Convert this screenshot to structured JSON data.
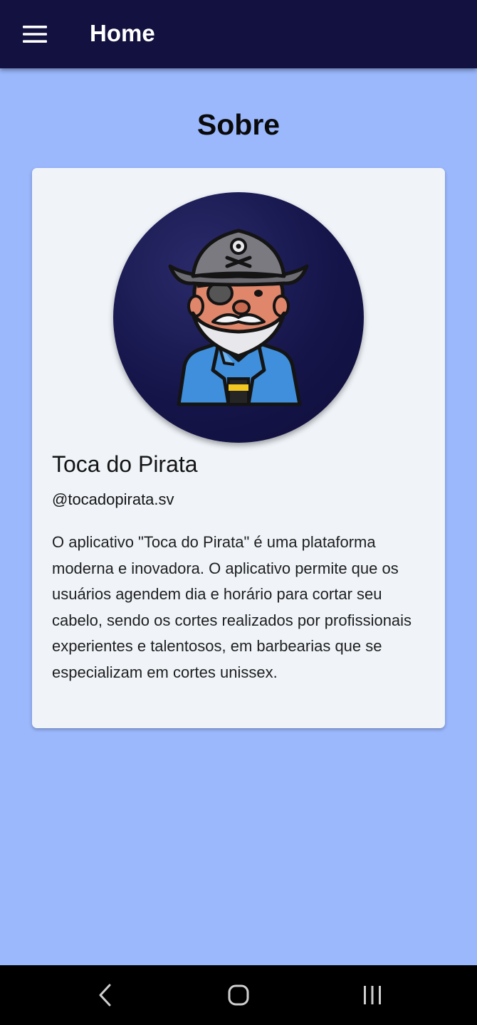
{
  "appbar": {
    "title": "Home",
    "menu_icon": "hamburger-menu-icon",
    "background_color": "#12113f"
  },
  "page": {
    "section_title": "Sobre",
    "background_color": "#9bb8fd"
  },
  "profile_card": {
    "name": "Toca do Pirata",
    "handle": "@tocadopirata.sv",
    "description": "O aplicativo \"Toca do Pirata\" é uma plataforma moderna e inovadora. O aplicativo permite que os usuários agendem dia e horário para cortar seu cabelo, sendo os cortes realizados por profissionais experientes e talentosos, em barbearias que se especializam em cortes unissex.",
    "avatar_icon": "pirate-avatar-icon"
  },
  "system_nav": {
    "back_icon": "back-chevron-icon",
    "home_icon": "home-circle-icon",
    "recents_icon": "recent-apps-icon"
  }
}
